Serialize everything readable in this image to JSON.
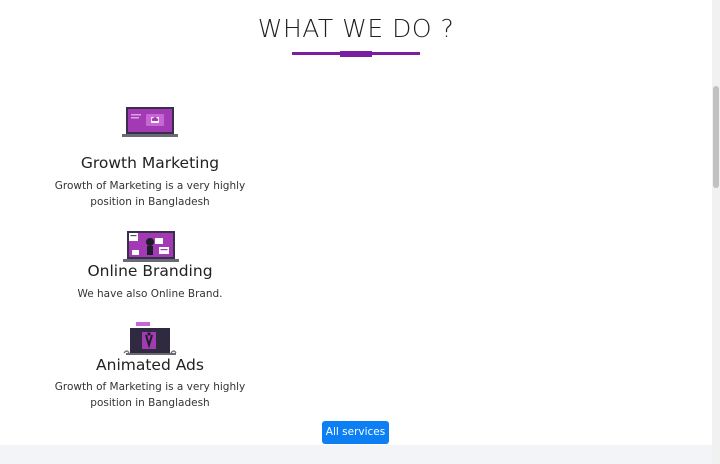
{
  "section": {
    "title": "WHAT WE DO ?"
  },
  "services": [
    {
      "title": "Growth Marketing",
      "description_line1": "Growth of Marketing is a very highly",
      "description_line2": "position in Bangladesh",
      "icon": "laptop-cloud-illustration"
    },
    {
      "title": "Online Branding",
      "description_line1": "We have also Online Brand.",
      "icon": "laptop-branding-illustration"
    },
    {
      "title": "Animated Ads",
      "description_line1": "Growth of Marketing is a very highly",
      "description_line2": "position in Bangladesh",
      "icon": "laptop-ads-illustration"
    }
  ],
  "cta": {
    "label": "All services"
  },
  "colors": {
    "accent": "#7b1fa2",
    "button": "#0d7ff5",
    "footer": "#f3f4f7"
  }
}
